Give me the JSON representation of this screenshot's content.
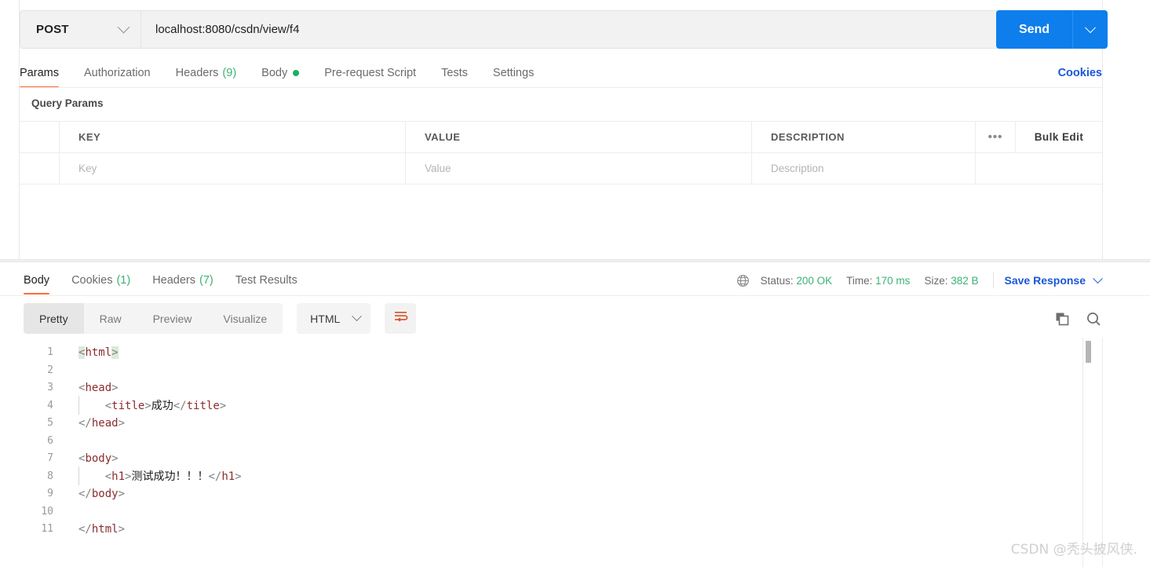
{
  "request": {
    "method": "POST",
    "url": "localhost:8080/csdn/view/f4",
    "send_label": "Send",
    "tabs": [
      {
        "label": "Params",
        "active": true,
        "count": null,
        "dot": false
      },
      {
        "label": "Authorization",
        "active": false,
        "count": null,
        "dot": false
      },
      {
        "label": "Headers",
        "active": false,
        "count": "(9)",
        "dot": false
      },
      {
        "label": "Body",
        "active": false,
        "count": null,
        "dot": true
      },
      {
        "label": "Pre-request Script",
        "active": false,
        "count": null,
        "dot": false
      },
      {
        "label": "Tests",
        "active": false,
        "count": null,
        "dot": false
      },
      {
        "label": "Settings",
        "active": false,
        "count": null,
        "dot": false
      }
    ],
    "cookies_link": "Cookies",
    "query_params_title": "Query Params",
    "table": {
      "headers": {
        "key": "KEY",
        "value": "VALUE",
        "description": "DESCRIPTION"
      },
      "bulk_edit": "Bulk Edit",
      "rows": [
        {
          "key": "Key",
          "value": "Value",
          "description": "Description"
        }
      ]
    }
  },
  "response": {
    "tabs": [
      {
        "label": "Body",
        "active": true,
        "count": null
      },
      {
        "label": "Cookies",
        "active": false,
        "count": "(1)"
      },
      {
        "label": "Headers",
        "active": false,
        "count": "(7)"
      },
      {
        "label": "Test Results",
        "active": false,
        "count": null
      }
    ],
    "status_label": "Status:",
    "status_value": "200 OK",
    "time_label": "Time:",
    "time_value": "170 ms",
    "size_label": "Size:",
    "size_value": "382 B",
    "save_response": "Save Response",
    "view_modes": [
      {
        "label": "Pretty",
        "active": true
      },
      {
        "label": "Raw",
        "active": false
      },
      {
        "label": "Preview",
        "active": false
      },
      {
        "label": "Visualize",
        "active": false
      }
    ],
    "language": "HTML",
    "code_lines": [
      {
        "n": "1",
        "indent": false,
        "parts": [
          {
            "t": "<",
            "c": "pn hl"
          },
          {
            "t": "html",
            "c": "tg"
          },
          {
            "t": ">",
            "c": "pn hl"
          }
        ]
      },
      {
        "n": "2",
        "indent": false,
        "parts": []
      },
      {
        "n": "3",
        "indent": false,
        "parts": [
          {
            "t": "<",
            "c": "pn"
          },
          {
            "t": "head",
            "c": "tg"
          },
          {
            "t": ">",
            "c": "pn"
          }
        ]
      },
      {
        "n": "4",
        "indent": true,
        "parts": [
          {
            "t": "    <",
            "c": "pn"
          },
          {
            "t": "title",
            "c": "tg"
          },
          {
            "t": ">",
            "c": "pn"
          },
          {
            "t": "成功",
            "c": "tx"
          },
          {
            "t": "</",
            "c": "pn"
          },
          {
            "t": "title",
            "c": "tg"
          },
          {
            "t": ">",
            "c": "pn"
          }
        ]
      },
      {
        "n": "5",
        "indent": false,
        "parts": [
          {
            "t": "</",
            "c": "pn"
          },
          {
            "t": "head",
            "c": "tg"
          },
          {
            "t": ">",
            "c": "pn"
          }
        ]
      },
      {
        "n": "6",
        "indent": false,
        "parts": []
      },
      {
        "n": "7",
        "indent": false,
        "parts": [
          {
            "t": "<",
            "c": "pn"
          },
          {
            "t": "body",
            "c": "tg"
          },
          {
            "t": ">",
            "c": "pn"
          }
        ]
      },
      {
        "n": "8",
        "indent": true,
        "parts": [
          {
            "t": "    <",
            "c": "pn"
          },
          {
            "t": "h1",
            "c": "tg"
          },
          {
            "t": ">",
            "c": "pn"
          },
          {
            "t": "测试成功！！！",
            "c": "tx"
          },
          {
            "t": "</",
            "c": "pn"
          },
          {
            "t": "h1",
            "c": "tg"
          },
          {
            "t": ">",
            "c": "pn"
          }
        ]
      },
      {
        "n": "9",
        "indent": false,
        "parts": [
          {
            "t": "</",
            "c": "pn"
          },
          {
            "t": "body",
            "c": "tg"
          },
          {
            "t": ">",
            "c": "pn"
          }
        ]
      },
      {
        "n": "10",
        "indent": false,
        "parts": []
      },
      {
        "n": "11",
        "indent": false,
        "parts": [
          {
            "t": "</",
            "c": "pn"
          },
          {
            "t": "html",
            "c": "tg"
          },
          {
            "t": ">",
            "c": "pn"
          }
        ]
      }
    ]
  },
  "watermark": "CSDN @秃头披风侠.",
  "colors": {
    "accent_orange": "#ff6c37",
    "send_blue": "#0d7eec",
    "link_blue": "#1a56db",
    "status_green": "#3bb273",
    "tag_red": "#8b2c2c"
  }
}
